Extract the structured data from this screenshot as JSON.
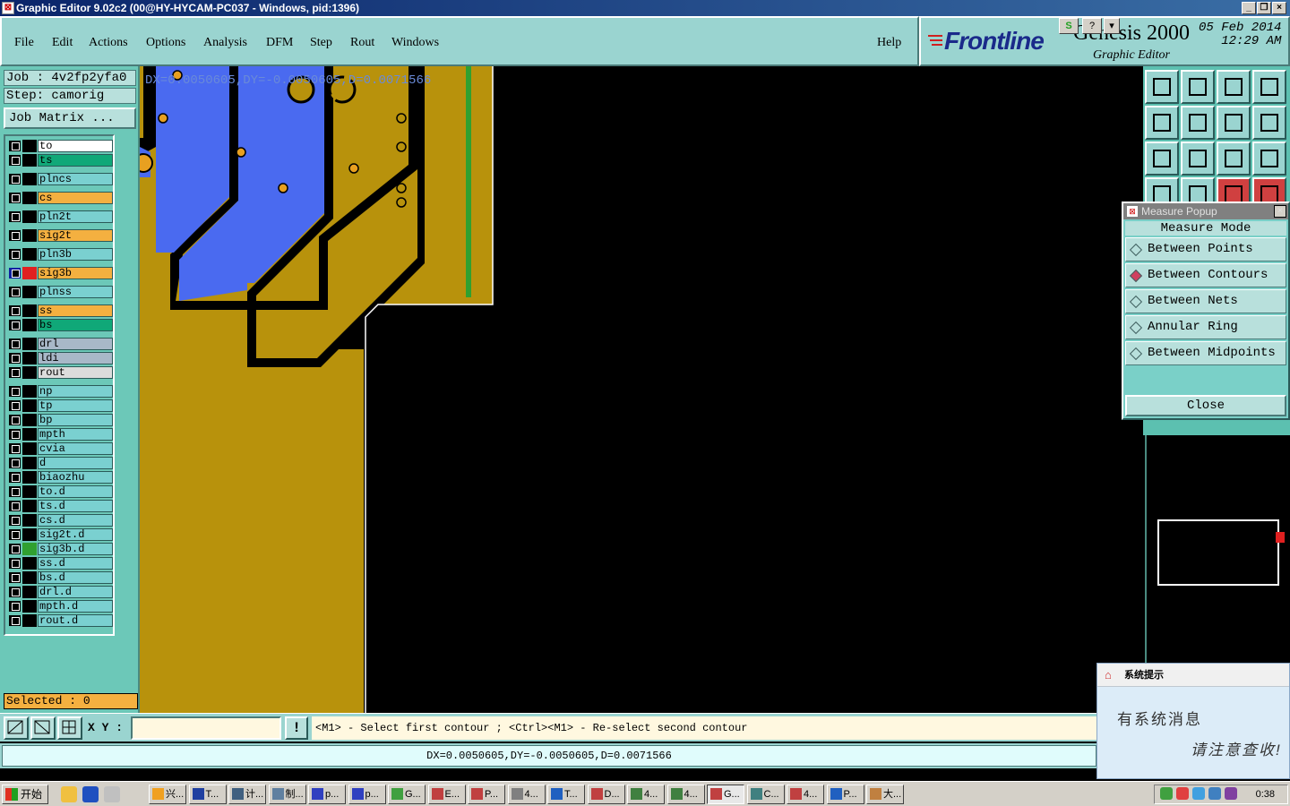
{
  "window": {
    "title": "Graphic Editor 9.02c2 (00@HY-HYCAM-PC037 - Windows, pid:1396)"
  },
  "menu": [
    "File",
    "Edit",
    "Actions",
    "Options",
    "Analysis",
    "DFM",
    "Step",
    "Rout",
    "Windows"
  ],
  "help_label": "Help",
  "brand": {
    "logo": "Frontline",
    "product": "Genesis 2000",
    "subtitle": "Graphic Editor",
    "date": "05 Feb 2014",
    "time": "12:29 AM"
  },
  "job": {
    "job_line": "Job : 4v2fp2yfa0",
    "step_line": "Step: camorig",
    "matrix_button": "Job Matrix ..."
  },
  "layers": [
    {
      "name": "to",
      "color": "#ffffff"
    },
    {
      "name": "ts",
      "color": "#10a878"
    },
    {
      "name": "plncs",
      "color": "#7ad0d0"
    },
    {
      "name": "cs",
      "color": "#f4b040"
    },
    {
      "name": "pln2t",
      "color": "#7ad0d0"
    },
    {
      "name": "sig2t",
      "color": "#f4b040"
    },
    {
      "name": "pln3b",
      "color": "#7ad0d0"
    },
    {
      "name": "sig3b",
      "color": "#f4b040",
      "active": true
    },
    {
      "name": "plnss",
      "color": "#7ad0d0"
    },
    {
      "name": "ss",
      "color": "#f4b040"
    },
    {
      "name": "bs",
      "color": "#10a878"
    },
    {
      "name": "drl",
      "color": "#a8b8c8"
    },
    {
      "name": "ldi",
      "color": "#a8b8c8"
    },
    {
      "name": "rout",
      "color": "#dcdcdc"
    },
    {
      "name": "np",
      "color": "#7ad0d0"
    },
    {
      "name": "tp",
      "color": "#7ad0d0"
    },
    {
      "name": "bp",
      "color": "#7ad0d0"
    },
    {
      "name": "mpth",
      "color": "#7ad0d0"
    },
    {
      "name": "cvia",
      "color": "#7ad0d0"
    },
    {
      "name": "d",
      "color": "#7ad0d0"
    },
    {
      "name": "biaozhu",
      "color": "#7ad0d0"
    },
    {
      "name": "to.d",
      "color": "#7ad0d0"
    },
    {
      "name": "ts.d",
      "color": "#7ad0d0"
    },
    {
      "name": "cs.d",
      "color": "#7ad0d0"
    },
    {
      "name": "sig2t.d",
      "color": "#7ad0d0"
    },
    {
      "name": "sig3b.d",
      "color": "#7ad0d0",
      "marked": true
    },
    {
      "name": "ss.d",
      "color": "#7ad0d0"
    },
    {
      "name": "bs.d",
      "color": "#7ad0d0"
    },
    {
      "name": "drl.d",
      "color": "#7ad0d0"
    },
    {
      "name": "mpth.d",
      "color": "#7ad0d0"
    },
    {
      "name": "rout.d",
      "color": "#7ad0d0"
    }
  ],
  "selected_label": "Selected : 0",
  "canvas": {
    "overlay_text": "DX=0.0050605,DY=-0.0050605,D=0.0071566"
  },
  "measure_popup": {
    "title": "Measure Popup",
    "mode_label": "Measure Mode",
    "options": [
      {
        "label": "Between Points",
        "selected": false
      },
      {
        "label": "Between Contours",
        "selected": true
      },
      {
        "label": "Between Nets",
        "selected": false
      },
      {
        "label": "Annular Ring",
        "selected": false
      },
      {
        "label": "Between Midpoints",
        "selected": false
      }
    ],
    "close_label": "Close"
  },
  "tools": [
    {
      "icon": "layer-up-icon"
    },
    {
      "icon": "layer-down-icon"
    },
    {
      "icon": "home-icon"
    },
    {
      "icon": "split-view-icon"
    },
    {
      "icon": "move-left-icon"
    },
    {
      "icon": "move-right-icon"
    },
    {
      "icon": "rotate-icon"
    },
    {
      "icon": "snap-icon"
    },
    {
      "icon": "fit-icon"
    },
    {
      "icon": "zoom-fit-icon"
    },
    {
      "icon": "scale-icon"
    },
    {
      "icon": "help-icon"
    },
    {
      "icon": "settings-icon"
    },
    {
      "icon": "grid-icon"
    },
    {
      "icon": "measure-icon"
    },
    {
      "icon": "measure2-icon"
    }
  ],
  "command": {
    "xy_label": "X Y :",
    "xy_value": "",
    "excl_label": "!",
    "prompt": "<M1> - Select first contour ; <Ctrl><M1> - Re-select second contour",
    "status": "DX=0.0050605,DY=-0.0050605,D=0.0071566"
  },
  "notification": {
    "title": "系统提示",
    "line1": "有系统消息",
    "line2": "请注意查收!"
  },
  "taskbar": {
    "start": "开始",
    "tasks": [
      "兴...",
      "T...",
      "计...",
      "制...",
      "p...",
      "p...",
      "G...",
      "E...",
      "P...",
      "4...",
      "T...",
      "D...",
      "4...",
      "4...",
      "G...",
      "C...",
      "4...",
      "P...",
      "大..."
    ],
    "active_index": 14,
    "clock": "0:38"
  }
}
